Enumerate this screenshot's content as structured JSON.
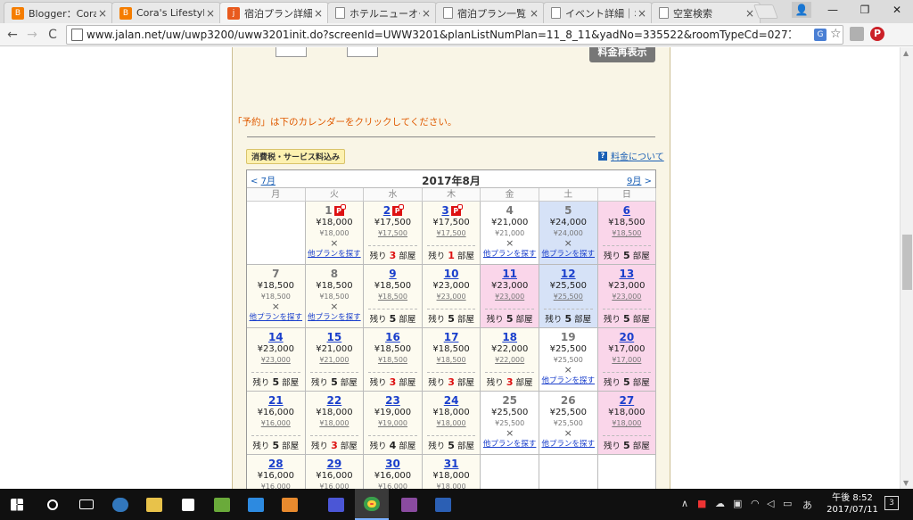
{
  "tabs": [
    {
      "title": "Blogger：Cora's",
      "icon": "blogger-icon"
    },
    {
      "title": "Cora's Lifestyle:",
      "icon": "blogger-icon"
    },
    {
      "title": "宿泊プラン詳細[ホ",
      "icon": "jalan-icon",
      "active": true
    },
    {
      "title": "ホテルニューオータニ",
      "icon": "document-icon"
    },
    {
      "title": "宿泊プラン一覧",
      "icon": "document-icon"
    },
    {
      "title": "イベント詳細｜ホ",
      "icon": "document-icon"
    },
    {
      "title": "空室検索",
      "icon": "document-icon"
    }
  ],
  "tab_close": "×",
  "window": {
    "user": "👤",
    "minimize": "—",
    "maximize": "❐",
    "close": "✕"
  },
  "toolbar": {
    "back": "←",
    "forward": "→",
    "reload": "C",
    "url": "www.jalan.net/uw/uwp3200/uww3201init.do?screenId=UWW3201&planListNumPlan=11_8_11&yadNo=335522&roomTypeCd=0271001&rootCd=7701&callbackH",
    "translate": "G",
    "star": "☆",
    "ext_pinterest": "P",
    "menu": "⋮"
  },
  "page": {
    "redisplay_button": "料金再表示",
    "notice": "「予約」は下のカレンダーをクリックしてください。",
    "tax_badge": "消費税・サービス料込み",
    "fee_link": "料金について",
    "fee_q": "?"
  },
  "calendar": {
    "month": "2017年8月",
    "prev": "7月",
    "next": "9月",
    "prev_arrow": "<",
    "next_arrow": ">",
    "weekdays": [
      "月",
      "火",
      "水",
      "木",
      "金",
      "土",
      "日"
    ],
    "rooms_prefix": "残り",
    "rooms_suffix": "部屋",
    "other_plan": "他プランを探す",
    "cross": "×",
    "p_icon": "P",
    "days": [
      {
        "empty": true
      },
      {
        "day": "1",
        "status": "full",
        "price": "¥18,000",
        "sub": "¥18,000",
        "p": true
      },
      {
        "day": "2",
        "price": "¥17,500",
        "sub": "¥17,500",
        "rooms": "3",
        "red": true,
        "p": true
      },
      {
        "day": "3",
        "price": "¥17,500",
        "sub": "¥17,500",
        "rooms": "1",
        "red": true,
        "p": true
      },
      {
        "day": "4",
        "status": "full",
        "price": "¥21,000",
        "sub": "¥21,000",
        "bg": "grey"
      },
      {
        "day": "5",
        "status": "full",
        "price": "¥24,000",
        "sub": "¥24,000",
        "bg": "sat"
      },
      {
        "day": "6",
        "price": "¥18,500",
        "sub": "¥18,500",
        "rooms": "5",
        "bg": "sun"
      },
      {
        "day": "7",
        "status": "full",
        "price": "¥18,500",
        "sub": "¥18,500"
      },
      {
        "day": "8",
        "status": "full",
        "price": "¥18,500",
        "sub": "¥18,500"
      },
      {
        "day": "9",
        "price": "¥18,500",
        "sub": "¥18,500",
        "rooms": "5"
      },
      {
        "day": "10",
        "price": "¥23,000",
        "sub": "¥23,000",
        "rooms": "5"
      },
      {
        "day": "11",
        "price": "¥23,000",
        "sub": "¥23,000",
        "rooms": "5",
        "bg": "sun"
      },
      {
        "day": "12",
        "price": "¥25,500",
        "sub": "¥25,500",
        "rooms": "5",
        "bg": "sat"
      },
      {
        "day": "13",
        "price": "¥23,000",
        "sub": "¥23,000",
        "rooms": "5",
        "bg": "sun"
      },
      {
        "day": "14",
        "price": "¥23,000",
        "sub": "¥23,000",
        "rooms": "5"
      },
      {
        "day": "15",
        "price": "¥21,000",
        "sub": "¥21,000",
        "rooms": "5"
      },
      {
        "day": "16",
        "price": "¥18,500",
        "sub": "¥18,500",
        "rooms": "3",
        "red": true
      },
      {
        "day": "17",
        "price": "¥18,500",
        "sub": "¥18,500",
        "rooms": "3",
        "red": true
      },
      {
        "day": "18",
        "price": "¥22,000",
        "sub": "¥22,000",
        "rooms": "3",
        "red": true
      },
      {
        "day": "19",
        "status": "full",
        "price": "¥25,500",
        "sub": "¥25,500",
        "bg": "grey"
      },
      {
        "day": "20",
        "price": "¥17,000",
        "sub": "¥17,000",
        "rooms": "5",
        "bg": "sun"
      },
      {
        "day": "21",
        "price": "¥16,000",
        "sub": "¥16,000",
        "rooms": "5"
      },
      {
        "day": "22",
        "price": "¥18,000",
        "sub": "¥18,000",
        "rooms": "3",
        "red": true
      },
      {
        "day": "23",
        "price": "¥19,000",
        "sub": "¥19,000",
        "rooms": "4"
      },
      {
        "day": "24",
        "price": "¥18,000",
        "sub": "¥18,000",
        "rooms": "5"
      },
      {
        "day": "25",
        "status": "full",
        "price": "¥25,500",
        "sub": "¥25,500",
        "bg": "grey"
      },
      {
        "day": "26",
        "status": "full",
        "price": "¥25,500",
        "sub": "¥25,500",
        "bg": "grey"
      },
      {
        "day": "27",
        "price": "¥18,000",
        "sub": "¥18,000",
        "rooms": "5",
        "bg": "sun"
      },
      {
        "day": "28",
        "price": "¥16,000",
        "sub": "¥16,000",
        "rooms": "5"
      },
      {
        "day": "29",
        "price": "¥16,000",
        "sub": "¥16,000",
        "rooms": "5"
      },
      {
        "day": "30",
        "price": "¥16,000",
        "sub": "¥16,000",
        "rooms": "5"
      },
      {
        "day": "31",
        "price": "¥18,000",
        "sub": "¥18,000",
        "rooms": "5"
      },
      {
        "empty": true
      },
      {
        "empty": true
      },
      {
        "empty": true
      }
    ]
  },
  "taskbar": {
    "time": "午後 8:52",
    "date": "2017/07/11",
    "ime": "あ",
    "notifications": "3",
    "apps": [
      "start-icon",
      "search-icon",
      "task-view-icon",
      "edge-icon",
      "file-explorer-icon",
      "store-icon",
      "mail-icon",
      "media-player-icon",
      "calculator-icon",
      "chrome-icon",
      "onenote-icon",
      "word-icon"
    ]
  }
}
